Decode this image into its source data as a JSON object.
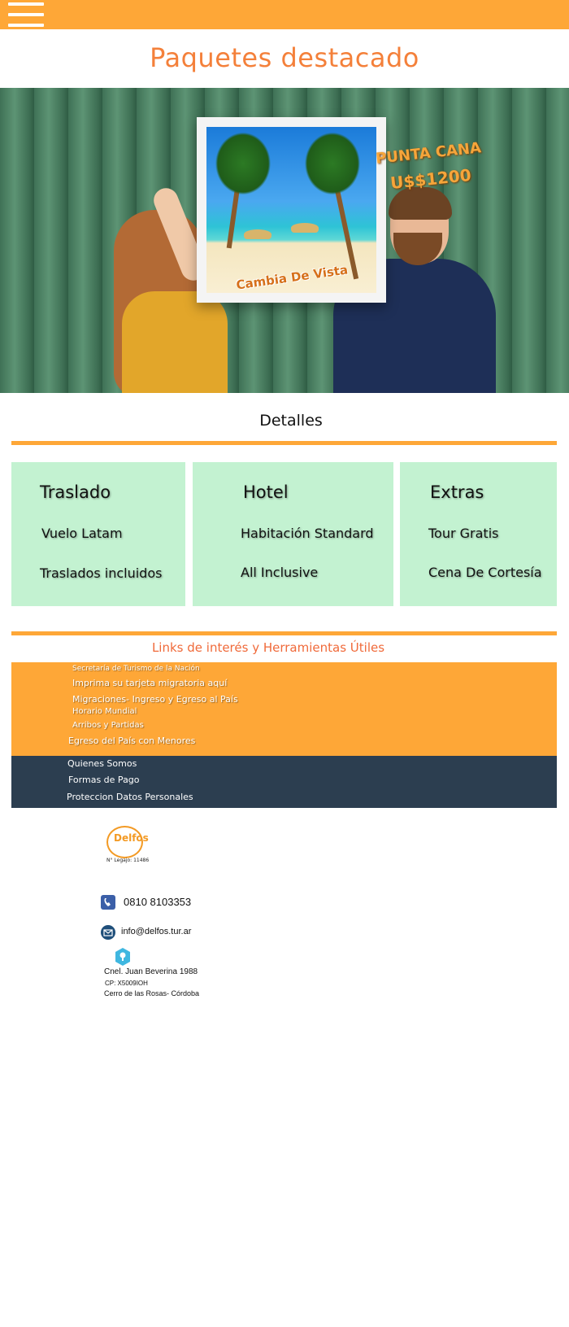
{
  "header": {
    "menu_icon": "hamburger-menu-icon",
    "bar_color": "#fea737"
  },
  "page_title": "Paquetes destacado",
  "hero": {
    "destination": "PUNTA CANA",
    "price": "U$$1200",
    "frame_caption": "Cambia De Vista"
  },
  "details": {
    "title": "Detalles",
    "cards": [
      {
        "title": "Traslado",
        "items": [
          "Vuelo Latam",
          "Traslados incluidos"
        ]
      },
      {
        "title": "Hotel",
        "items": [
          "Habitación Standard",
          "All Inclusive"
        ]
      },
      {
        "title": "Extras",
        "items": [
          "Tour Gratis",
          "Cena De Cortesía"
        ]
      }
    ],
    "card_color": "#c3f2d1"
  },
  "links": {
    "title": "Links de interés y Herramientas Útiles",
    "items": [
      "Secretaría de Turismo de la Nación",
      "Imprima su tarjeta migratoria aquí",
      "Migraciones- Ingreso y Egreso al País",
      "Horario Mundial",
      "Arribos y Partidas",
      "Egreso del País con Menores"
    ]
  },
  "footer_nav": {
    "items": [
      "Quienes Somos",
      "Formas de Pago",
      "Proteccion Datos Personales"
    ]
  },
  "company": {
    "logo_text": "Delfos",
    "legajo": "N° Legajo: 11486",
    "phone": "0810 8103353",
    "email": "info@delfos.tur.ar",
    "address_line1": "Cnel. Juan Beverina 1988",
    "address_line2": "CP: X5009IOH",
    "address_line3": "Cerro de las Rosas- Córdoba",
    "phone_icon": "phone-icon",
    "email_icon": "envelope-icon",
    "location_icon": "location-pin-icon"
  }
}
